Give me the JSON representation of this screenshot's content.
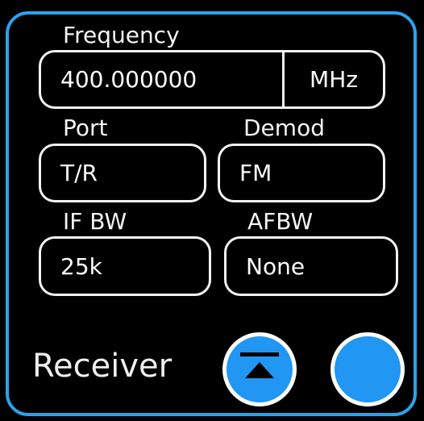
{
  "colors": {
    "background": "#000000",
    "panel_border": "#2aa3ee",
    "button_fill": "#2196f3",
    "field_border": "#f2f2f2"
  },
  "frequency": {
    "label": "Frequency",
    "value": "400.000000",
    "unit": "MHz"
  },
  "port": {
    "label": "Port",
    "value": "T/R"
  },
  "demod": {
    "label": "Demod",
    "value": "FM"
  },
  "if_bw": {
    "label": "IF BW",
    "value": "25k"
  },
  "afbw": {
    "label": "AFBW",
    "value": "None"
  },
  "panel": {
    "title": "Receiver"
  },
  "icons": {
    "collapse_button": "collapse-up-icon",
    "blank_button": "circle-button"
  }
}
